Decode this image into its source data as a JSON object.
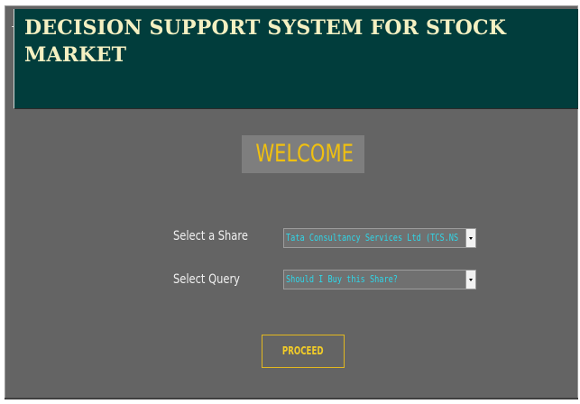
{
  "header": {
    "title": "DECISION SUPPORT SYSTEM FOR STOCK MARKET"
  },
  "welcome": {
    "text": "WELCOME"
  },
  "form": {
    "share_label": "Select a Share",
    "share_value": "Tata Consultancy Services Ltd (TCS.NS",
    "query_label": "Select Query",
    "query_value": "Should I Buy this Share?",
    "proceed_label": "PROCEED"
  },
  "colors": {
    "header_bg": "#013d3c",
    "panel_bg": "#646464",
    "title_text": "#f4f0c2",
    "accent_yellow": "#f0c010",
    "select_text": "#2fd6e8"
  },
  "icons": {
    "dropdown": "chevron-down-icon"
  }
}
